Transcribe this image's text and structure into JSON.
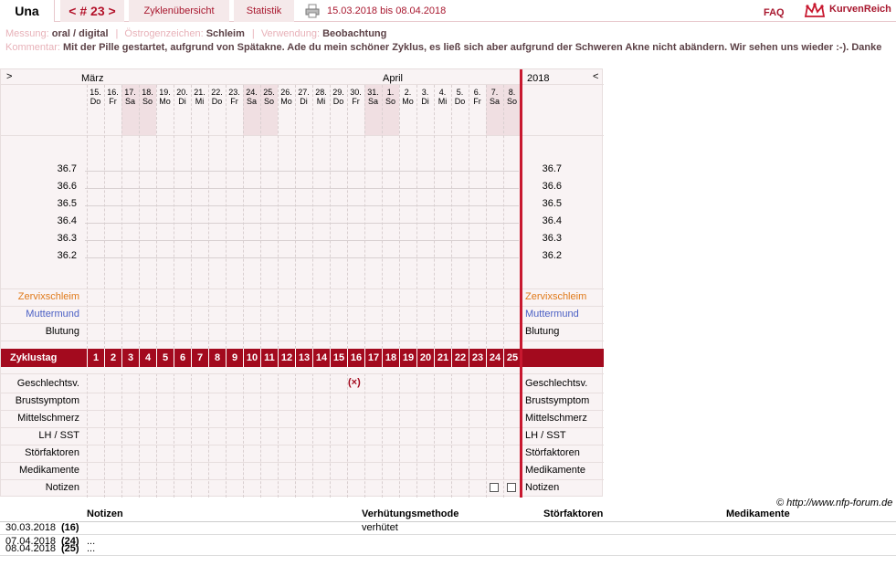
{
  "header": {
    "name": "Una",
    "cycle_prev": "<",
    "cycle_label": "# 23",
    "cycle_next": ">",
    "tab_overview": "Zyklenübersicht",
    "tab_stats": "Statistik",
    "date_range": "15.03.2018 bis 08.04.2018",
    "faq": "FAQ",
    "logo_text": "KurvenReich"
  },
  "meta": {
    "messung_label": "Messung:",
    "messung_value": "oral / digital",
    "oestrogen_label": "Östrogenzeichen:",
    "oestrogen_value": "Schleim",
    "verwendung_label": "Verwendung:",
    "verwendung_value": "Beobachtung",
    "kommentar_label": "Kommentar:",
    "kommentar_value": "Mit der Pille gestartet, aufgrund von Spätakne. Ade du mein schöner Zyklus, es ließ sich aber aufgrund der Schweren Akne nicht abändern. Wir sehen uns wieder :-). Danke"
  },
  "chart": {
    "nav_left": ">",
    "nav_right": "<",
    "month_1": "März",
    "month_2": "April",
    "year": "2018",
    "days": [
      {
        "d": "15.",
        "w": "Do"
      },
      {
        "d": "16.",
        "w": "Fr"
      },
      {
        "d": "17.",
        "w": "Sa"
      },
      {
        "d": "18.",
        "w": "So"
      },
      {
        "d": "19.",
        "w": "Mo"
      },
      {
        "d": "20.",
        "w": "Di"
      },
      {
        "d": "21.",
        "w": "Mi"
      },
      {
        "d": "22.",
        "w": "Do"
      },
      {
        "d": "23.",
        "w": "Fr"
      },
      {
        "d": "24.",
        "w": "Sa"
      },
      {
        "d": "25.",
        "w": "So"
      },
      {
        "d": "26.",
        "w": "Mo"
      },
      {
        "d": "27.",
        "w": "Di"
      },
      {
        "d": "28.",
        "w": "Mi"
      },
      {
        "d": "29.",
        "w": "Do"
      },
      {
        "d": "30.",
        "w": "Fr"
      },
      {
        "d": "31.",
        "w": "Sa"
      },
      {
        "d": "1.",
        "w": "So"
      },
      {
        "d": "2.",
        "w": "Mo"
      },
      {
        "d": "3.",
        "w": "Di"
      },
      {
        "d": "4.",
        "w": "Mi"
      },
      {
        "d": "5.",
        "w": "Do"
      },
      {
        "d": "6.",
        "w": "Fr"
      },
      {
        "d": "7.",
        "w": "Sa"
      },
      {
        "d": "8.",
        "w": "So"
      }
    ],
    "temps": [
      "36.7",
      "36.6",
      "36.5",
      "36.4",
      "36.3",
      "36.2"
    ],
    "row_zervix": "Zervixschleim",
    "row_muttermund": "Muttermund",
    "row_blutung": "Blutung",
    "zyklustag_label": "Zyklustag",
    "zyklustage": [
      "1",
      "2",
      "3",
      "4",
      "5",
      "6",
      "7",
      "8",
      "9",
      "10",
      "11",
      "12",
      "13",
      "14",
      "15",
      "16",
      "17",
      "18",
      "19",
      "20",
      "21",
      "22",
      "23",
      "24",
      "25"
    ],
    "row_gv": "Geschlechtsv.",
    "row_brust": "Brustsymptom",
    "row_mittel": "Mittelschmerz",
    "row_lh": "LH / SST",
    "row_stoer": "Störfaktoren",
    "row_medi": "Medikamente",
    "row_notizen": "Notizen",
    "gv_mark": "(×)",
    "colors": {
      "zervix": "#e07a1a",
      "muttermund": "#4a5fc4",
      "accent": "#a30a1e"
    }
  },
  "copyright": "© http://www.nfp-forum.de",
  "bottom": {
    "col_notizen": "Notizen",
    "col_methode": "Verhütungsmethode",
    "col_stoer": "Störfaktoren",
    "col_medi": "Medikamente",
    "rows": [
      {
        "date": "30.03.2018",
        "day": "(16)",
        "note": "",
        "method": "verhütet"
      },
      {
        "date": "07.04.2018",
        "day": "(24)",
        "note": "...",
        "method": ""
      },
      {
        "date": "08.04.2018",
        "day": "(25)",
        "note": "...",
        "method": ""
      }
    ]
  }
}
